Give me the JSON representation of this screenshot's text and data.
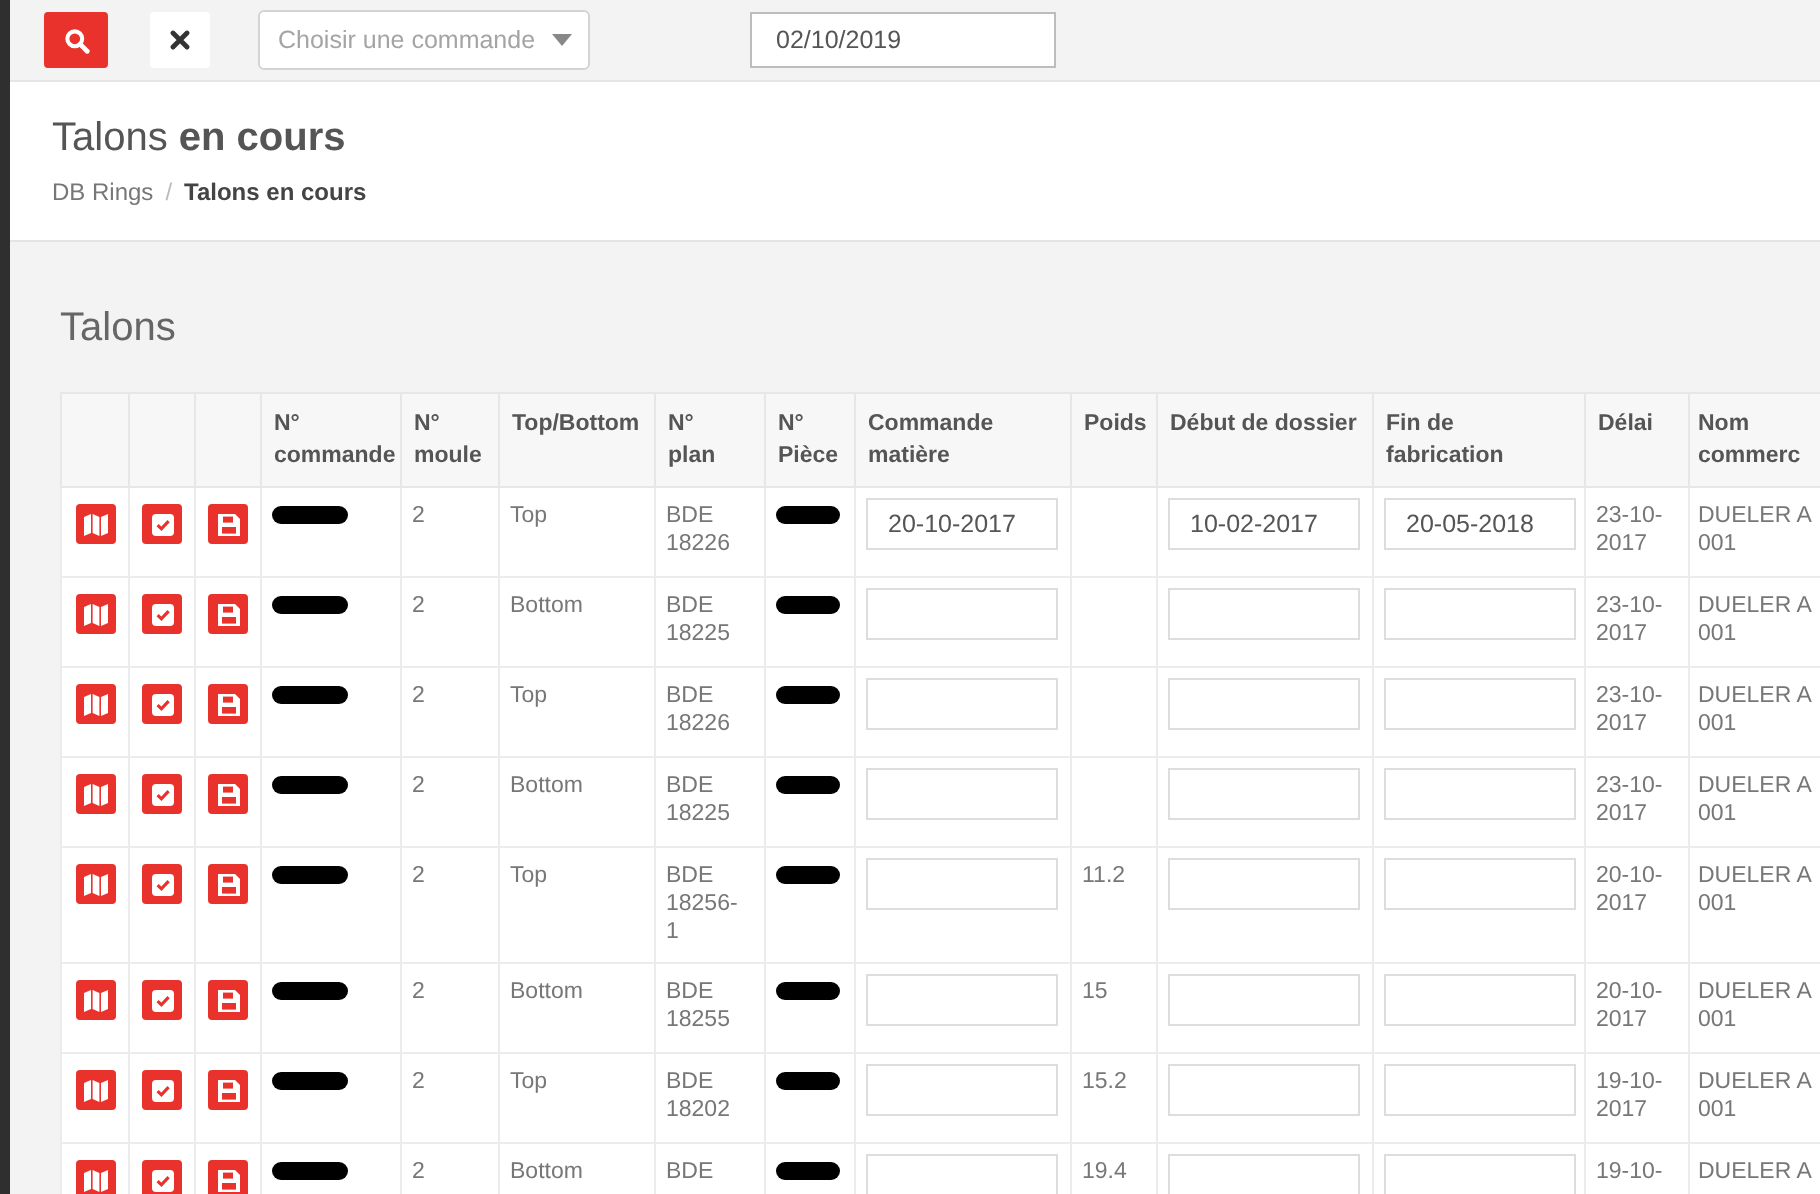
{
  "toolbar": {
    "order_select": {
      "placeholder": "Choisir une commande"
    },
    "date_field": {
      "value": "02/10/2019"
    }
  },
  "page_header": {
    "title_light": "Talons",
    "title_bold": "en cours",
    "separator": "/",
    "breadcrumb": [
      {
        "label": "DB Rings",
        "current": false
      },
      {
        "label": "Talons en cours",
        "current": true
      }
    ]
  },
  "section_title": "Talons",
  "table": {
    "columns": [
      "",
      "",
      "",
      "N°\ncommande",
      "N°\nmoule",
      "Top/Bottom",
      "N°\nplan",
      "N°\nPièce",
      "Commande\nmatière",
      "Poids",
      "Début de dossier",
      "Fin de fabrication",
      "Délai",
      "Nom\ncommerc"
    ],
    "rows": [
      {
        "moule": "2",
        "position": "Top",
        "plan": "BDE\n18226",
        "commande_matiere": "20-10-2017",
        "poids": "",
        "debut": "10-02-2017",
        "fin": "20-05-2018",
        "delai": "23-10-\n2017",
        "nom": "DUELER A\n001"
      },
      {
        "moule": "2",
        "position": "Bottom",
        "plan": "BDE\n18225",
        "commande_matiere": "",
        "poids": "",
        "debut": "",
        "fin": "",
        "delai": "23-10-\n2017",
        "nom": "DUELER A\n001"
      },
      {
        "moule": "2",
        "position": "Top",
        "plan": "BDE\n18226",
        "commande_matiere": "",
        "poids": "",
        "debut": "",
        "fin": "",
        "delai": "23-10-\n2017",
        "nom": "DUELER A\n001"
      },
      {
        "moule": "2",
        "position": "Bottom",
        "plan": "BDE\n18225",
        "commande_matiere": "",
        "poids": "",
        "debut": "",
        "fin": "",
        "delai": "23-10-\n2017",
        "nom": "DUELER A\n001"
      },
      {
        "moule": "2",
        "position": "Top",
        "plan": "BDE\n18256-\n1",
        "commande_matiere": "",
        "poids": "11.2",
        "debut": "",
        "fin": "",
        "delai": "20-10-\n2017",
        "nom": "DUELER A\n001"
      },
      {
        "moule": "2",
        "position": "Bottom",
        "plan": "BDE\n18255",
        "commande_matiere": "",
        "poids": "15",
        "debut": "",
        "fin": "",
        "delai": "20-10-\n2017",
        "nom": "DUELER A\n001"
      },
      {
        "moule": "2",
        "position": "Top",
        "plan": "BDE\n18202",
        "commande_matiere": "",
        "poids": "15.2",
        "debut": "",
        "fin": "",
        "delai": "19-10-\n2017",
        "nom": "DUELER A\n001"
      },
      {
        "moule": "2",
        "position": "Bottom",
        "plan": "BDE",
        "commande_matiere": "",
        "poids": "19.4",
        "debut": "",
        "fin": "",
        "delai": "19-10-",
        "nom": "DUELER A"
      }
    ]
  }
}
